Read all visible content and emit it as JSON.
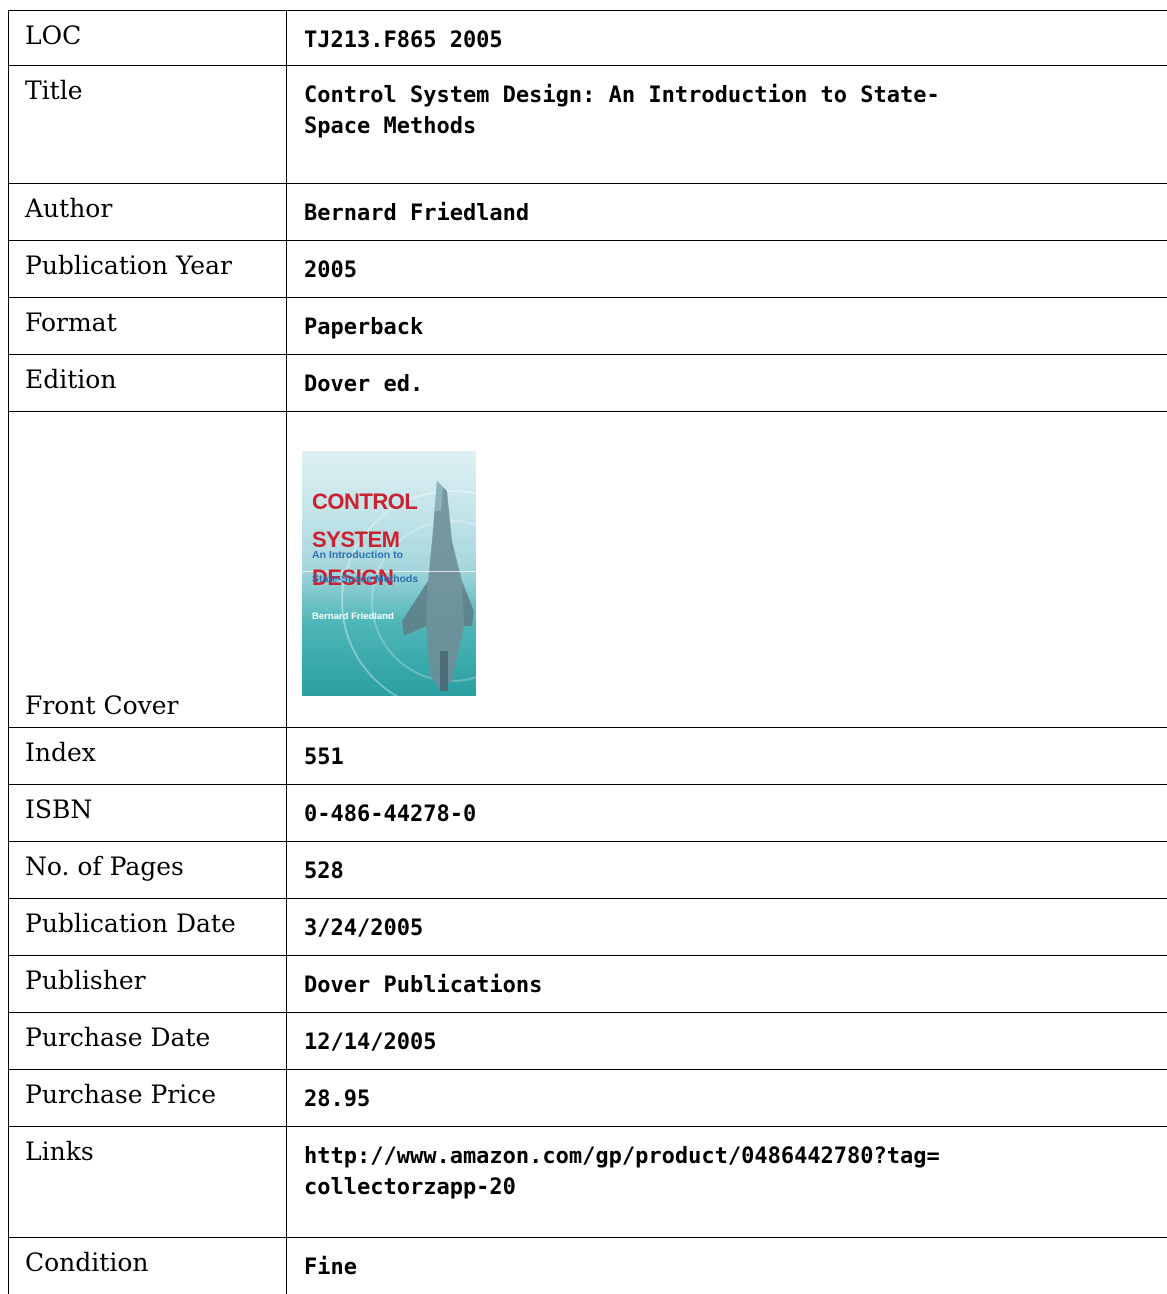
{
  "rows": [
    {
      "label": "LOC",
      "value": "TJ213.F865 2005"
    },
    {
      "label": "Title",
      "value": "Control System Design: An Introduction to State-\nSpace Methods"
    },
    {
      "label": "Author",
      "value": "Bernard Friedland"
    },
    {
      "label": "Publication Year",
      "value": "2005"
    },
    {
      "label": "Format",
      "value": "Paperback"
    },
    {
      "label": "Edition",
      "value": "Dover ed."
    },
    {
      "label": "Front Cover"
    },
    {
      "label": "Index",
      "value": "551"
    },
    {
      "label": "ISBN",
      "value": "0-486-44278-0"
    },
    {
      "label": "No. of Pages",
      "value": "528"
    },
    {
      "label": "Publication Date",
      "value": "3/24/2005"
    },
    {
      "label": "Publisher",
      "value": "Dover Publications"
    },
    {
      "label": "Purchase Date",
      "value": "12/14/2005"
    },
    {
      "label": "Purchase Price",
      "value": "28.95"
    },
    {
      "label": "Links",
      "value": "http://www.amazon.com/gp/product/0486442780?tag=\ncollectorzapp-20"
    },
    {
      "label": "Condition",
      "value": "Fine"
    }
  ],
  "cover": {
    "title_lines": [
      "CONTROL",
      "SYSTEM",
      "DESIGN"
    ],
    "subtitle_lines": [
      "An Introduction to",
      "State-Space Methods"
    ],
    "author": "Bernard Friedland",
    "colors": {
      "title": "#cc2130",
      "subtitle": "#2a6fb0",
      "background": "#a6d6dd"
    }
  }
}
